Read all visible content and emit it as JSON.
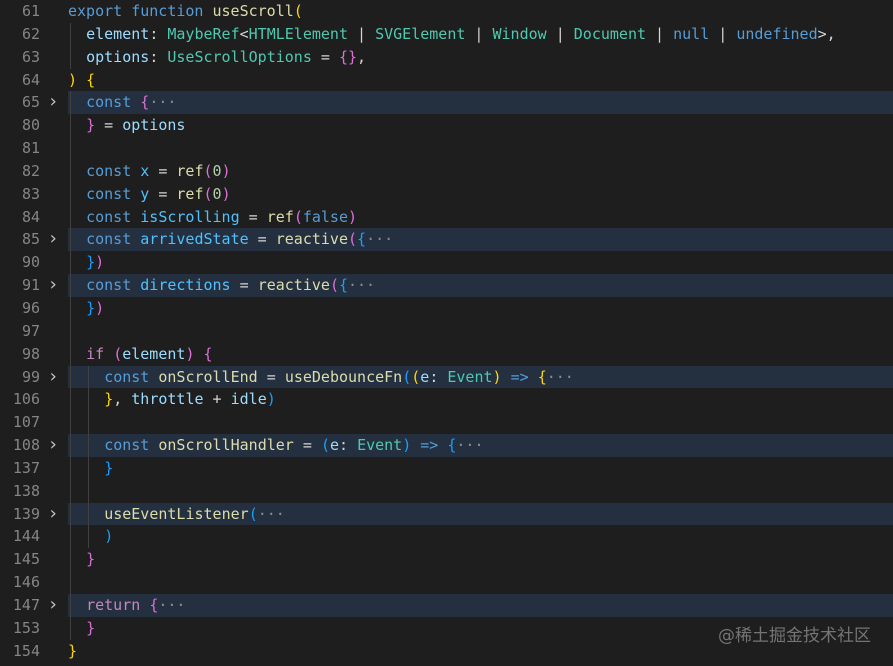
{
  "editor": {
    "watermark": "@稀土掘金技术社区",
    "fold_icon": "chevron-right-icon",
    "colors": {
      "background": "#1e1e1e",
      "folded_highlight": "#243040",
      "line_number": "#858585",
      "keyword": "#569cd6",
      "function": "#dcdcaa",
      "variable": "#9cdcfe",
      "type": "#4ec9b0"
    },
    "lines": [
      {
        "num": "61",
        "fold": false,
        "indent": 0,
        "tokens": [
          [
            "kw",
            "export "
          ],
          [
            "kw",
            "function "
          ],
          [
            "fn",
            "useScroll"
          ],
          [
            "b1",
            "("
          ]
        ]
      },
      {
        "num": "62",
        "fold": false,
        "indent": 1,
        "tokens": [
          [
            "var",
            "element"
          ],
          [
            "op",
            ": "
          ],
          [
            "type",
            "MaybeRef"
          ],
          [
            "op",
            "<"
          ],
          [
            "type",
            "HTMLElement"
          ],
          [
            "op",
            " | "
          ],
          [
            "type",
            "SVGElement"
          ],
          [
            "op",
            " | "
          ],
          [
            "type",
            "Window"
          ],
          [
            "op",
            " | "
          ],
          [
            "type",
            "Document"
          ],
          [
            "op",
            " | "
          ],
          [
            "kw",
            "null"
          ],
          [
            "op",
            " | "
          ],
          [
            "kw",
            "undefined"
          ],
          [
            "op",
            ">,"
          ]
        ]
      },
      {
        "num": "63",
        "fold": false,
        "indent": 1,
        "tokens": [
          [
            "var",
            "options"
          ],
          [
            "op",
            ": "
          ],
          [
            "type",
            "UseScrollOptions"
          ],
          [
            "op",
            " = "
          ],
          [
            "b2",
            "{}"
          ],
          [
            "op",
            ","
          ]
        ]
      },
      {
        "num": "64",
        "fold": false,
        "indent": 0,
        "tokens": [
          [
            "b1",
            ")"
          ],
          [
            "op",
            " "
          ],
          [
            "b1",
            "{"
          ]
        ]
      },
      {
        "num": "65",
        "fold": true,
        "indent": 1,
        "tokens": [
          [
            "kw",
            "const "
          ],
          [
            "b2",
            "{"
          ],
          [
            "ell",
            "···"
          ]
        ]
      },
      {
        "num": "80",
        "fold": false,
        "indent": 1,
        "tokens": [
          [
            "b2",
            "}"
          ],
          [
            "op",
            " = "
          ],
          [
            "var",
            "options"
          ]
        ]
      },
      {
        "num": "81",
        "fold": false,
        "indent": 1,
        "tokens": []
      },
      {
        "num": "82",
        "fold": false,
        "indent": 1,
        "tokens": [
          [
            "kw",
            "const "
          ],
          [
            "const",
            "x"
          ],
          [
            "op",
            " = "
          ],
          [
            "fn",
            "ref"
          ],
          [
            "b2",
            "("
          ],
          [
            "num",
            "0"
          ],
          [
            "b2",
            ")"
          ]
        ]
      },
      {
        "num": "83",
        "fold": false,
        "indent": 1,
        "tokens": [
          [
            "kw",
            "const "
          ],
          [
            "const",
            "y"
          ],
          [
            "op",
            " = "
          ],
          [
            "fn",
            "ref"
          ],
          [
            "b2",
            "("
          ],
          [
            "num",
            "0"
          ],
          [
            "b2",
            ")"
          ]
        ]
      },
      {
        "num": "84",
        "fold": false,
        "indent": 1,
        "tokens": [
          [
            "kw",
            "const "
          ],
          [
            "const",
            "isScrolling"
          ],
          [
            "op",
            " = "
          ],
          [
            "fn",
            "ref"
          ],
          [
            "b2",
            "("
          ],
          [
            "kw",
            "false"
          ],
          [
            "b2",
            ")"
          ]
        ]
      },
      {
        "num": "85",
        "fold": true,
        "indent": 1,
        "tokens": [
          [
            "kw",
            "const "
          ],
          [
            "const",
            "arrivedState"
          ],
          [
            "op",
            " = "
          ],
          [
            "fn",
            "reactive"
          ],
          [
            "b2",
            "("
          ],
          [
            "b3",
            "{"
          ],
          [
            "ell",
            "···"
          ]
        ]
      },
      {
        "num": "90",
        "fold": false,
        "indent": 1,
        "tokens": [
          [
            "b3",
            "}"
          ],
          [
            "b2",
            ")"
          ]
        ]
      },
      {
        "num": "91",
        "fold": true,
        "indent": 1,
        "tokens": [
          [
            "kw",
            "const "
          ],
          [
            "const",
            "directions"
          ],
          [
            "op",
            " = "
          ],
          [
            "fn",
            "reactive"
          ],
          [
            "b2",
            "("
          ],
          [
            "b3",
            "{"
          ],
          [
            "ell",
            "···"
          ]
        ]
      },
      {
        "num": "96",
        "fold": false,
        "indent": 1,
        "tokens": [
          [
            "b3",
            "}"
          ],
          [
            "b2",
            ")"
          ]
        ]
      },
      {
        "num": "97",
        "fold": false,
        "indent": 1,
        "tokens": []
      },
      {
        "num": "98",
        "fold": false,
        "indent": 1,
        "tokens": [
          [
            "ctl",
            "if "
          ],
          [
            "b2",
            "("
          ],
          [
            "var",
            "element"
          ],
          [
            "b2",
            ")"
          ],
          [
            "op",
            " "
          ],
          [
            "b2",
            "{"
          ]
        ]
      },
      {
        "num": "99",
        "fold": true,
        "indent": 2,
        "tokens": [
          [
            "kw",
            "const "
          ],
          [
            "fn",
            "onScrollEnd"
          ],
          [
            "op",
            " = "
          ],
          [
            "fn",
            "useDebounceFn"
          ],
          [
            "b3",
            "("
          ],
          [
            "b1",
            "("
          ],
          [
            "var",
            "e"
          ],
          [
            "op",
            ": "
          ],
          [
            "type",
            "Event"
          ],
          [
            "b1",
            ")"
          ],
          [
            "op",
            " "
          ],
          [
            "kw",
            "=>"
          ],
          [
            "op",
            " "
          ],
          [
            "b1",
            "{"
          ],
          [
            "ell",
            "···"
          ]
        ]
      },
      {
        "num": "106",
        "fold": false,
        "indent": 2,
        "tokens": [
          [
            "b1",
            "}"
          ],
          [
            "op",
            ", "
          ],
          [
            "var",
            "throttle"
          ],
          [
            "op",
            " + "
          ],
          [
            "var",
            "idle"
          ],
          [
            "b3",
            ")"
          ]
        ]
      },
      {
        "num": "107",
        "fold": false,
        "indent": 2,
        "tokens": []
      },
      {
        "num": "108",
        "fold": true,
        "indent": 2,
        "tokens": [
          [
            "kw",
            "const "
          ],
          [
            "fn",
            "onScrollHandler"
          ],
          [
            "op",
            " = "
          ],
          [
            "b3",
            "("
          ],
          [
            "var",
            "e"
          ],
          [
            "op",
            ": "
          ],
          [
            "type",
            "Event"
          ],
          [
            "b3",
            ")"
          ],
          [
            "op",
            " "
          ],
          [
            "kw",
            "=>"
          ],
          [
            "op",
            " "
          ],
          [
            "b3",
            "{"
          ],
          [
            "ell",
            "···"
          ]
        ]
      },
      {
        "num": "137",
        "fold": false,
        "indent": 2,
        "tokens": [
          [
            "b3",
            "}"
          ]
        ]
      },
      {
        "num": "138",
        "fold": false,
        "indent": 2,
        "tokens": []
      },
      {
        "num": "139",
        "fold": true,
        "indent": 2,
        "tokens": [
          [
            "fn",
            "useEventListener"
          ],
          [
            "b3",
            "("
          ],
          [
            "ell",
            "···"
          ]
        ]
      },
      {
        "num": "144",
        "fold": false,
        "indent": 2,
        "tokens": [
          [
            "b3",
            ")"
          ]
        ]
      },
      {
        "num": "145",
        "fold": false,
        "indent": 1,
        "tokens": [
          [
            "b2",
            "}"
          ]
        ]
      },
      {
        "num": "146",
        "fold": false,
        "indent": 1,
        "tokens": []
      },
      {
        "num": "147",
        "fold": true,
        "indent": 1,
        "tokens": [
          [
            "ctl",
            "return "
          ],
          [
            "b2",
            "{"
          ],
          [
            "ell",
            "···"
          ]
        ]
      },
      {
        "num": "153",
        "fold": false,
        "indent": 1,
        "tokens": [
          [
            "b2",
            "}"
          ]
        ]
      },
      {
        "num": "154",
        "fold": false,
        "indent": 0,
        "tokens": [
          [
            "b1",
            "}"
          ]
        ]
      }
    ]
  }
}
